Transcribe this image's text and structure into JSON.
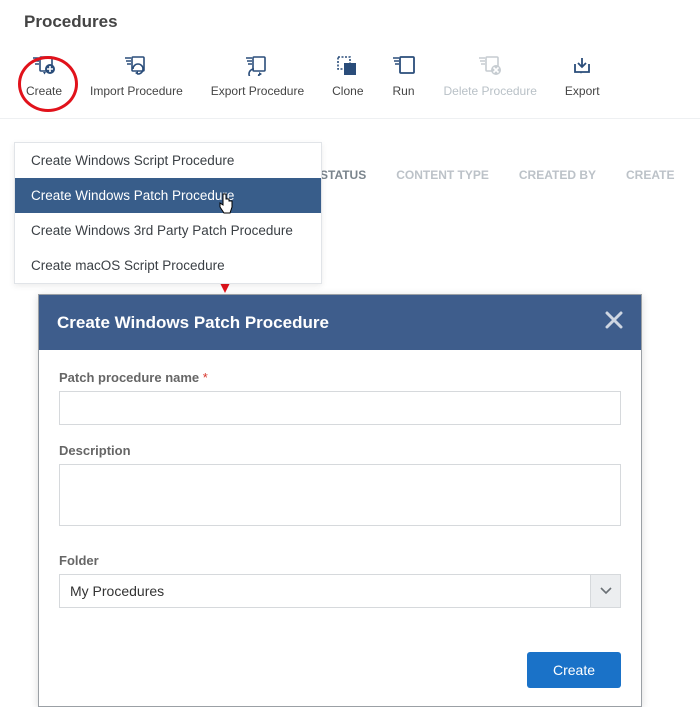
{
  "page": {
    "title": "Procedures"
  },
  "toolbar": {
    "create": "Create",
    "import": "Import Procedure",
    "export_proc": "Export Procedure",
    "clone": "Clone",
    "run": "Run",
    "delete": "Delete Procedure",
    "export": "Export"
  },
  "columns": {
    "status": "STATUS",
    "content_type": "CONTENT TYPE",
    "created_by": "CREATED BY",
    "created": "CREATE"
  },
  "dropdown": {
    "items": [
      "Create Windows Script Procedure",
      "Create Windows Patch Procedure",
      "Create Windows 3rd Party Patch Procedure",
      "Create macOS Script Procedure"
    ]
  },
  "dialog": {
    "title": "Create Windows Patch Procedure",
    "name_label": "Patch procedure name",
    "required": "*",
    "desc_label": "Description",
    "folder_label": "Folder",
    "folder_value": "My Procedures",
    "create_btn": "Create"
  },
  "colors": {
    "accent": "#3e5d8c",
    "primary_btn": "#1a72c8",
    "highlight_ring": "#e1121b"
  }
}
